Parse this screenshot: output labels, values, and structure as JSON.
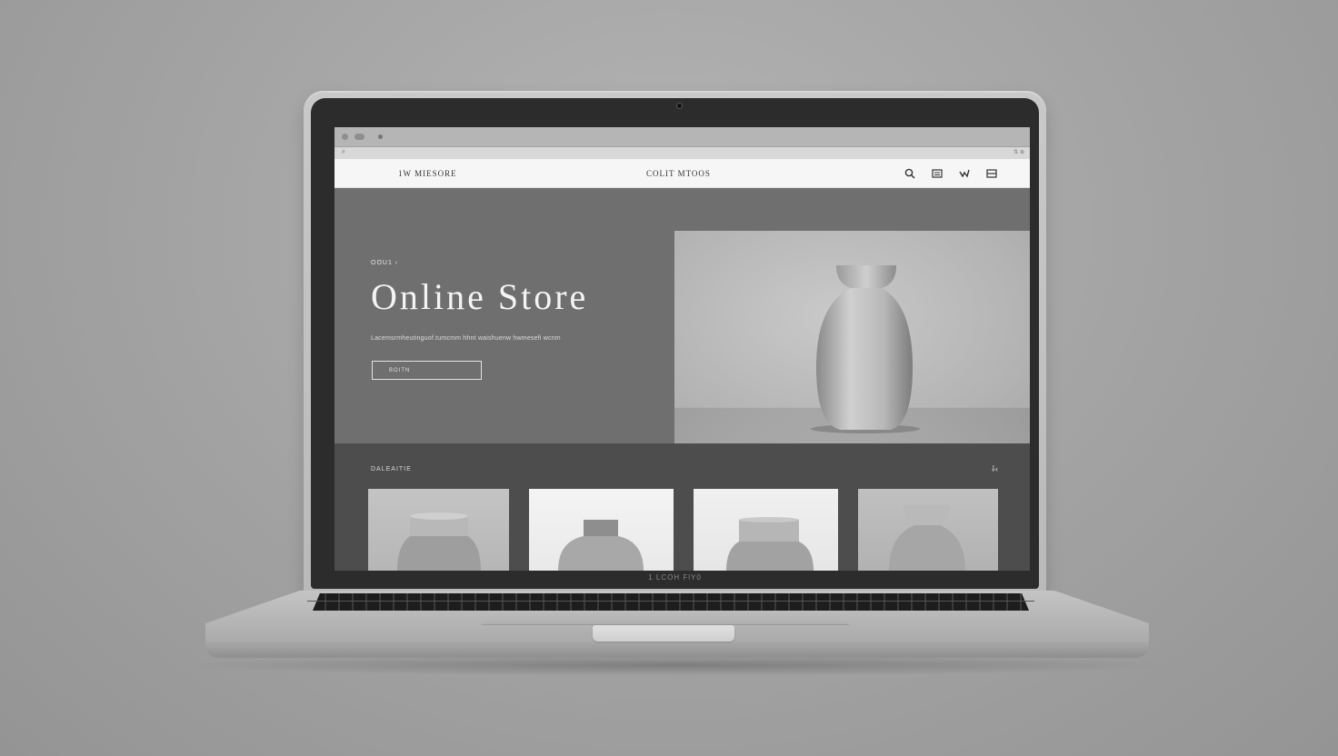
{
  "window": {
    "addr_left": "#",
    "addr_right": "⇅ ⊕"
  },
  "site": {
    "brand": "1W MIESORE",
    "nav_center": "COLIT MTOOS",
    "nav_icons": [
      "search-icon",
      "list-icon",
      "share-icon",
      "menu-icon"
    ]
  },
  "hero": {
    "eyebrow": "OOU1 ‹",
    "title": "Online Store",
    "subtitle": "Lacemsrmheutinguof.tumcmm hhnt waishuenw hwmesefi wcnm",
    "button_label": "BOITN"
  },
  "collection": {
    "title": "DALEAITIE",
    "arrow": "⸸‹"
  },
  "laptop": {
    "lid_label": "1 LCOH FlY0"
  },
  "colors": {
    "hero_bg": "#6f6f6f",
    "collection_bg": "#4d4d4d",
    "nav_bg": "#f6f6f6"
  }
}
